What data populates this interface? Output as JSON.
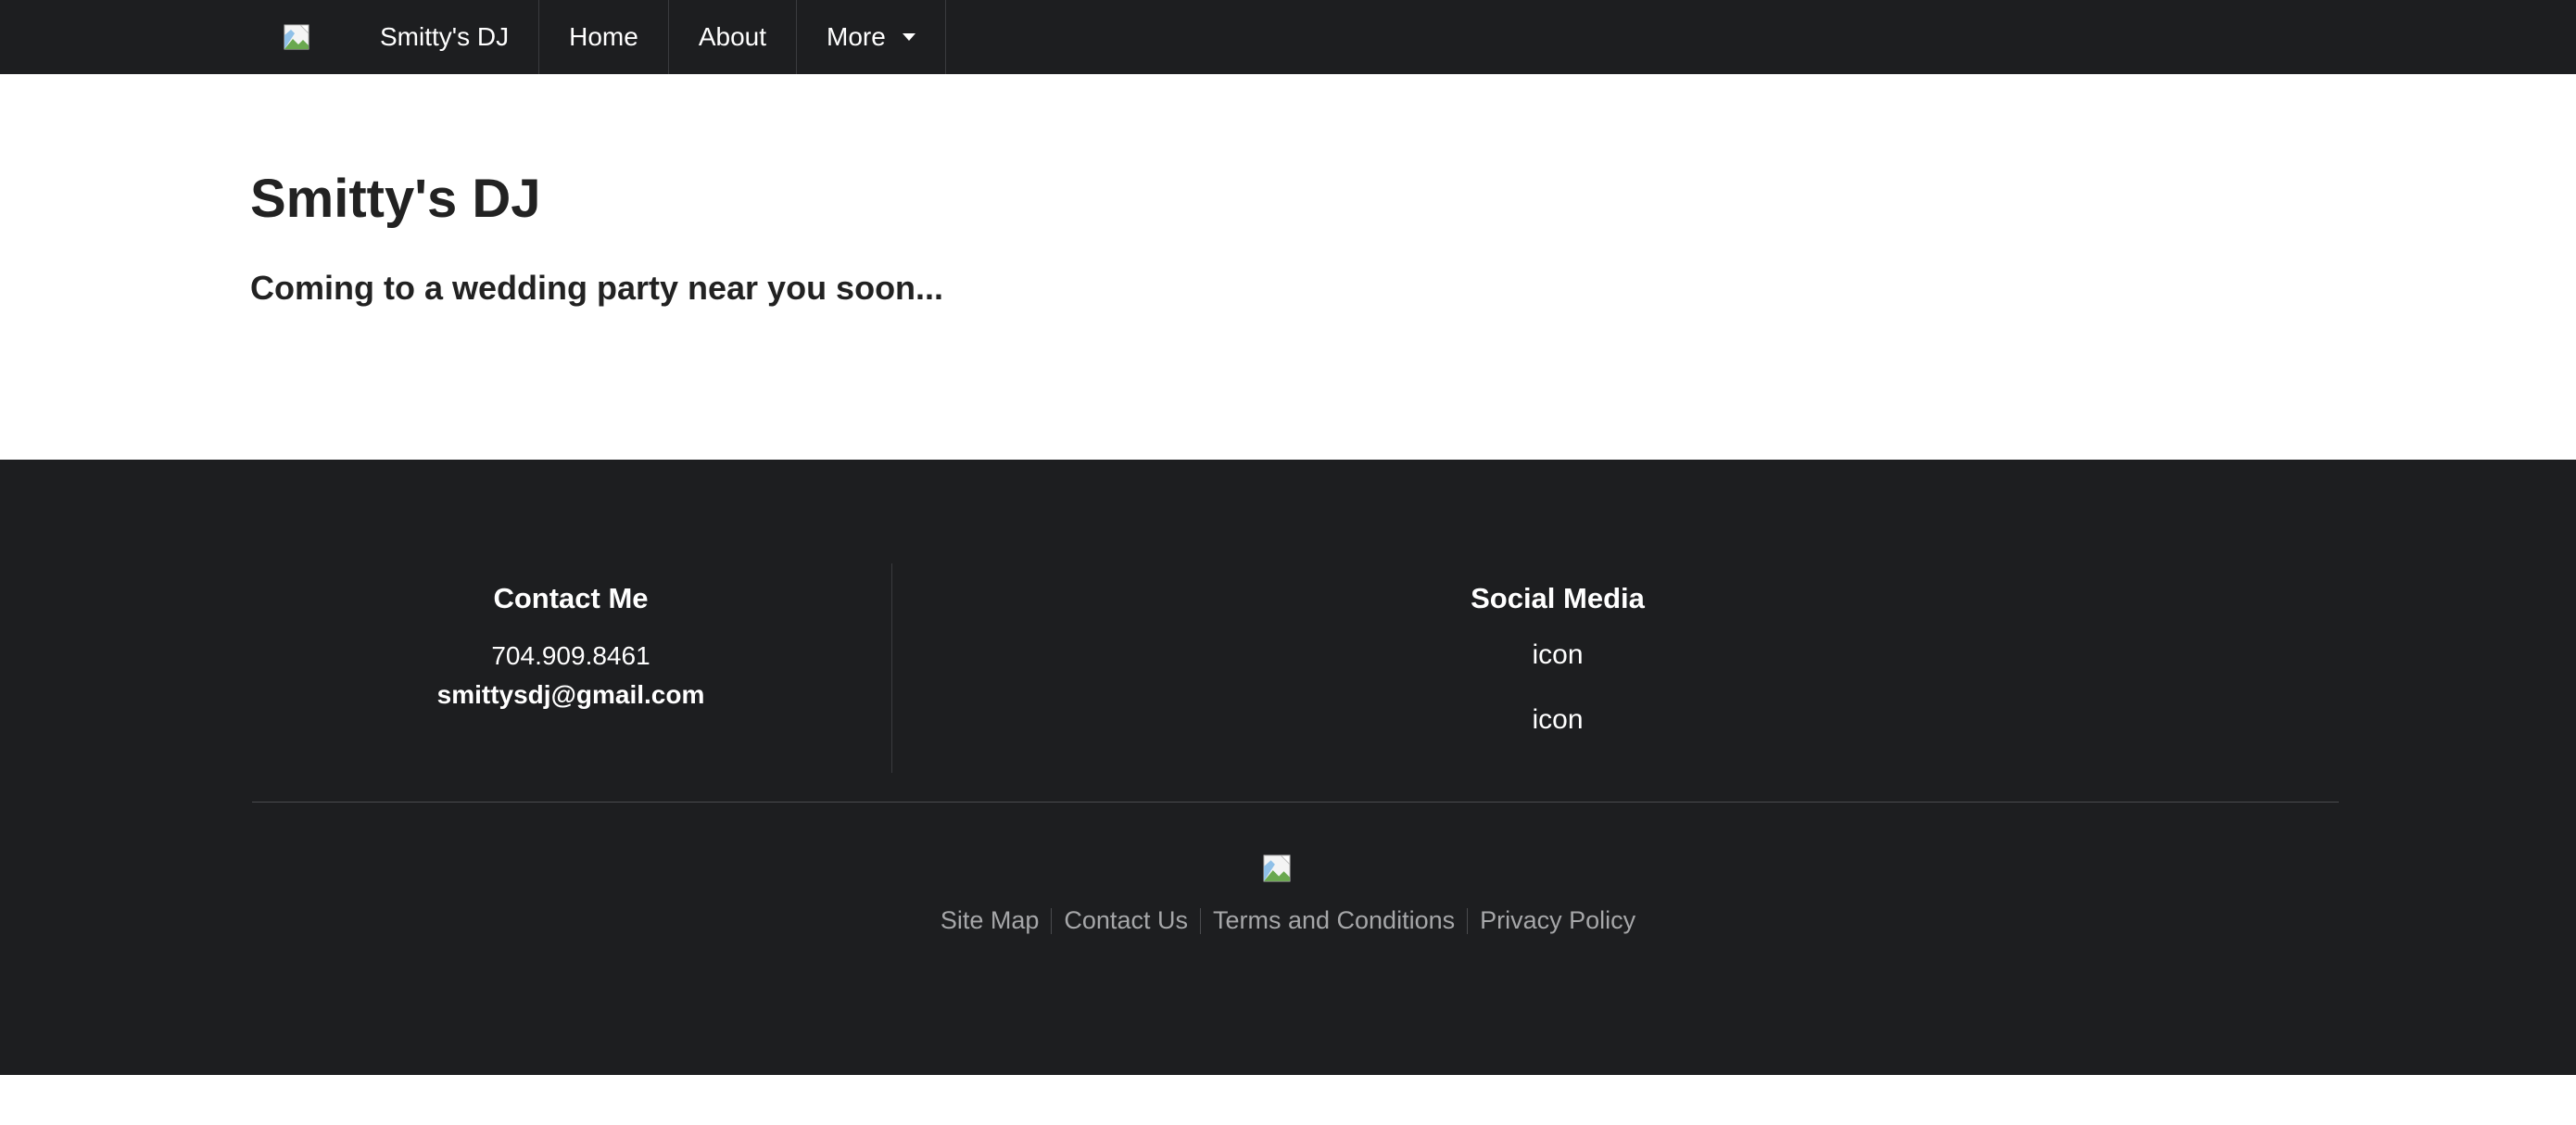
{
  "nav": {
    "brand": "Smitty's DJ",
    "links": [
      {
        "label": "Home"
      },
      {
        "label": "About"
      },
      {
        "label": "More"
      }
    ]
  },
  "hero": {
    "title": "Smitty's DJ",
    "subtitle": "Coming to a wedding party near you soon..."
  },
  "footer": {
    "contact": {
      "heading": "Contact Me",
      "phone": "704.909.8461",
      "email": "smittysdj@gmail.com"
    },
    "social": {
      "heading": "Social Media",
      "icons": [
        "icon",
        "icon"
      ]
    },
    "links": [
      "Site Map",
      "Contact Us",
      "Terms and Conditions",
      "Privacy Policy"
    ]
  },
  "colors": {
    "nav_bg": "#1d1e20",
    "footer_bg": "#1d1e20",
    "footer_link": "#a6a7a9"
  }
}
